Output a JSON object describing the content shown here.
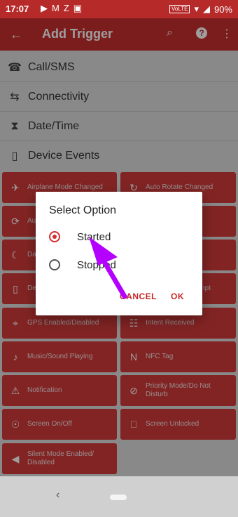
{
  "status": {
    "time": "17:07",
    "notif_icons": [
      "▶",
      "M",
      "Z",
      "▣"
    ],
    "volte": "VoLTE",
    "battery": "90%"
  },
  "appbar": {
    "title": "Add Trigger",
    "back_icon": "←",
    "search_icon": "⌕",
    "help_icon": "?",
    "menu_icon": "⋮"
  },
  "categories": [
    {
      "label": "Call/SMS",
      "icon": "☎"
    },
    {
      "label": "Connectivity",
      "icon": "⇆"
    },
    {
      "label": "Date/Time",
      "icon": "⧗"
    },
    {
      "label": "Device Events",
      "icon": "▯"
    }
  ],
  "triggers": [
    {
      "label": "Airplane Mode Changed",
      "icon": "✈"
    },
    {
      "label": "Auto Rotate Changed",
      "icon": "↻"
    },
    {
      "label": "Au",
      "icon": "⟳"
    },
    {
      "label": "",
      "icon": ""
    },
    {
      "label": "Da",
      "icon": "☾"
    },
    {
      "label": "",
      "icon": ""
    },
    {
      "label": "De",
      "icon": "▯"
    },
    {
      "label": "npt",
      "icon": ""
    },
    {
      "label": "GPS Enabled/Disabled",
      "icon": "⌖"
    },
    {
      "label": "Intent Received",
      "icon": "☷"
    },
    {
      "label": "Music/Sound Playing",
      "icon": "♪"
    },
    {
      "label": "NFC Tag",
      "icon": "N"
    },
    {
      "label": "Notification",
      "icon": "⚠"
    },
    {
      "label": "Priority Mode/Do Not Disturb",
      "icon": "⊘"
    },
    {
      "label": "Screen On/Off",
      "icon": "☉"
    },
    {
      "label": "Screen Unlocked",
      "icon": "⎕"
    },
    {
      "label": "Silent Mode Enabled/ Disabled",
      "icon": "◀"
    }
  ],
  "dialog": {
    "title": "Select Option",
    "options": [
      {
        "label": "Started",
        "selected": true
      },
      {
        "label": "Stopped",
        "selected": false
      }
    ],
    "cancel_label": "CANCEL",
    "ok_label": "OK"
  },
  "navbar": {
    "back_icon": "‹"
  },
  "colors": {
    "primary": "#c83030",
    "tile": "#d43a3a",
    "accent": "#d32f2f",
    "annotation": "#b400ff"
  }
}
